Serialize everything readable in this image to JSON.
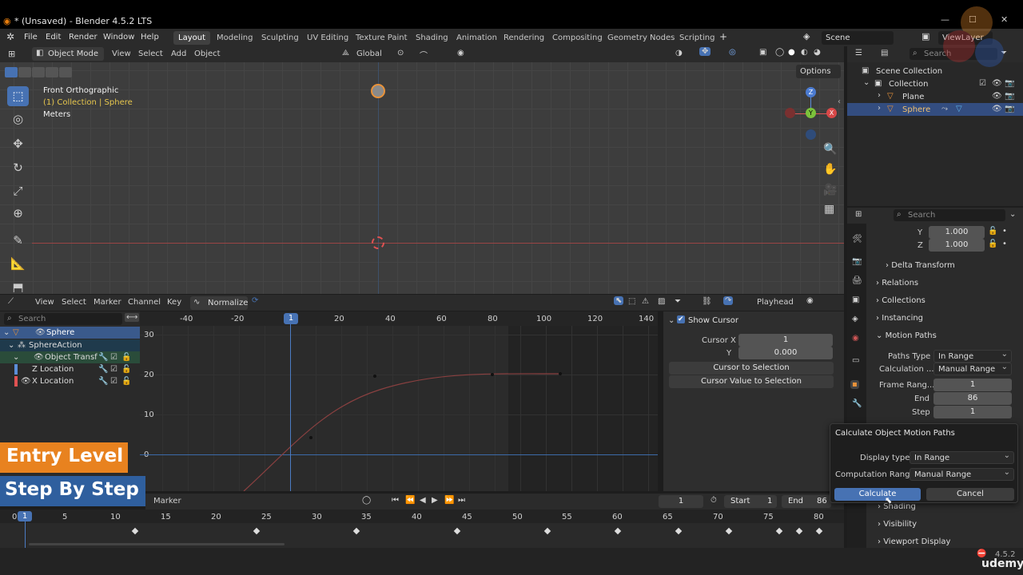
{
  "window": {
    "title": "* (Unsaved) - Blender 4.5.2 LTS",
    "minimize": "—",
    "maximize": "☐",
    "close": "✕"
  },
  "menu": {
    "items": [
      "File",
      "Edit",
      "Render",
      "Window",
      "Help"
    ]
  },
  "workspaces": [
    "Layout",
    "Modeling",
    "Sculpting",
    "UV Editing",
    "Texture Paint",
    "Shading",
    "Animation",
    "Rendering",
    "Compositing",
    "Geometry Nodes",
    "Scripting"
  ],
  "workspace_add": "+",
  "scene": {
    "name": "Scene",
    "view_layer": "ViewLayer"
  },
  "viewport": {
    "mode": "Object Mode",
    "menus": [
      "View",
      "Select",
      "Add",
      "Object"
    ],
    "transform": "Global",
    "options": "Options",
    "overlay_title": "Front Orthographic",
    "overlay_collection": "(1) Collection | Sphere",
    "overlay_units": "Meters",
    "gizmo": {
      "z": "Z",
      "y": "Y",
      "x": "X"
    }
  },
  "graph": {
    "menus": [
      "View",
      "Select",
      "Marker",
      "Channel",
      "Key"
    ],
    "normalize": "Normalize",
    "playhead": "Playhead",
    "search_placeholder": "Search",
    "x_ticks": [
      "-40",
      "-20",
      "20",
      "40",
      "60",
      "80",
      "100",
      "120",
      "140"
    ],
    "current_frame": "1",
    "y_ticks": [
      "30",
      "20",
      "10",
      "0"
    ],
    "channels": [
      "Sphere",
      "SphereAction",
      "Object Transfor",
      "Z Location",
      "X Location"
    ],
    "sidebar": {
      "show_cursor": "Show Cursor",
      "cursor_x_label": "Cursor X",
      "cursor_x": "1",
      "y_label": "Y",
      "y_value": "0.000",
      "to_selection": "Cursor to Selection",
      "value_to_selection": "Cursor Value to Selection"
    }
  },
  "timeline": {
    "marker": "Marker",
    "frame": "1",
    "start_label": "Start",
    "start": "1",
    "end_label": "End",
    "end": "86",
    "ticks": [
      "0",
      "5",
      "10",
      "15",
      "20",
      "25",
      "30",
      "35",
      "40",
      "45",
      "50",
      "55",
      "60",
      "65",
      "70",
      "75",
      "80"
    ],
    "current": "1"
  },
  "outliner": {
    "search_placeholder": "Search",
    "scene_collection": "Scene Collection",
    "collection": "Collection",
    "plane": "Plane",
    "sphere": "Sphere"
  },
  "properties": {
    "search_placeholder": "Search",
    "y_label": "Y",
    "y_value": "1.000",
    "z_label": "Z",
    "z_value": "1.000",
    "delta_transform": "Delta Transform",
    "relations": "Relations",
    "collections": "Collections",
    "instancing": "Instancing",
    "motion_paths": "Motion Paths",
    "paths_type_label": "Paths Type",
    "paths_type": "In Range",
    "calculation_label": "Calculation ...",
    "calculation": "Manual Range",
    "frame_range_label": "Frame Rang...",
    "frame_range": "1",
    "end_label": "End",
    "end": "86",
    "step_label": "Step",
    "step": "1",
    "shading": "Shading",
    "visibility": "Visibility",
    "viewport_display": "Viewport Display"
  },
  "popup": {
    "title": "Calculate Object Motion Paths",
    "display_type_label": "Display type",
    "display_type": "In Range",
    "computation_range_label": "Computation Range",
    "computation_range": "Manual Range",
    "calculate": "Calculate",
    "cancel": "Cancel"
  },
  "overlays": {
    "entry_level": "Entry Level",
    "step_by_step": "Step By Step"
  },
  "statusbar": {
    "version": "4.5.2",
    "brand": "udemy"
  }
}
